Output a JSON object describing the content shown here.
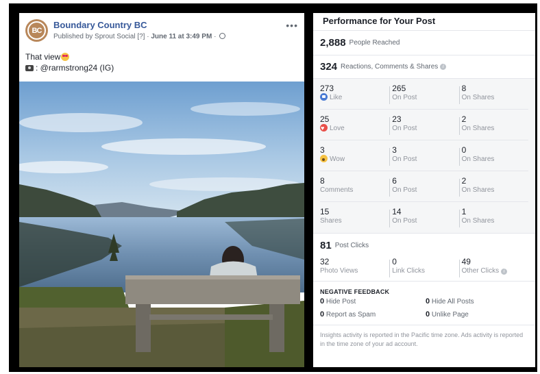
{
  "post": {
    "page_name": "Boundary Country BC",
    "avatar_text": "BC",
    "published_by": "Published by",
    "publisher": "Sprout Social",
    "help_marker": "[?]",
    "separator": "·",
    "date": "June 11 at 3:49 PM",
    "more_label": "•••",
    "text_line1": "That view",
    "text_line2": ": @rarmstrong24 (IG)"
  },
  "panel": {
    "title": "Performance for Your Post",
    "reach": {
      "value": "2,888",
      "label": "People Reached"
    },
    "engagement": {
      "value": "324",
      "label": "Reactions, Comments & Shares"
    },
    "reactions": [
      {
        "total": "273",
        "label": "Like",
        "icon": "like-icon",
        "on_post": "265",
        "on_post_label": "On Post",
        "on_shares": "8",
        "on_shares_label": "On Shares"
      },
      {
        "total": "25",
        "label": "Love",
        "icon": "love-icon",
        "on_post": "23",
        "on_post_label": "On Post",
        "on_shares": "2",
        "on_shares_label": "On Shares"
      },
      {
        "total": "3",
        "label": "Wow",
        "icon": "wow-icon",
        "on_post": "3",
        "on_post_label": "On Post",
        "on_shares": "0",
        "on_shares_label": "On Shares"
      },
      {
        "total": "8",
        "label": "Comments",
        "on_post": "6",
        "on_post_label": "On Post",
        "on_shares": "2",
        "on_shares_label": "On Shares"
      },
      {
        "total": "15",
        "label": "Shares",
        "on_post": "14",
        "on_post_label": "On Post",
        "on_shares": "1",
        "on_shares_label": "On Shares"
      }
    ],
    "post_clicks": {
      "value": "81",
      "label": "Post Clicks"
    },
    "clicks": [
      {
        "value": "32",
        "label": "Photo Views"
      },
      {
        "value": "0",
        "label": "Link Clicks"
      },
      {
        "value": "49",
        "label": "Other Clicks"
      }
    ],
    "negative_title": "NEGATIVE FEEDBACK",
    "negative": [
      {
        "value": "0",
        "label": "Hide Post"
      },
      {
        "value": "0",
        "label": "Hide All Posts"
      },
      {
        "value": "0",
        "label": "Report as Spam"
      },
      {
        "value": "0",
        "label": "Unlike Page"
      }
    ],
    "footnote": "Insights activity is reported in the Pacific time zone. Ads activity is reported in the time zone of your ad account."
  },
  "colors": {
    "page_link": "#365899",
    "like": "#4a7bd3",
    "love": "#e8504a",
    "wow": "#f6c243"
  }
}
